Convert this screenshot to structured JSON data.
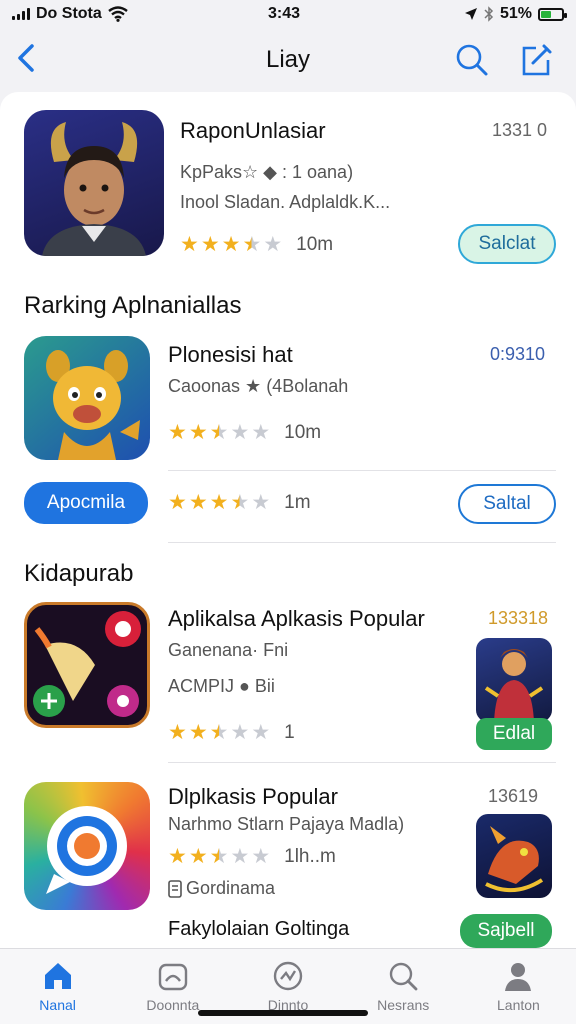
{
  "status_bar": {
    "carrier": "Do Stota",
    "time": "3:43",
    "battery": "51%",
    "battery_level": 0.51
  },
  "nav": {
    "title": "Liay"
  },
  "featured": {
    "name": "RaponUnlasiar",
    "code": "1331 0",
    "meta_line1": "KpPaks☆  ◆ : 1 oana)",
    "meta_line2": "Inool Sladan.  Adplaldk.K...",
    "rating": 3.5,
    "count": "10m",
    "button": "Salclat"
  },
  "ranking": {
    "section_title": "Rarking Aplnaniallas",
    "app": {
      "name": "Plonesisi hat",
      "code": "0:9310",
      "meta": "Caoonas ★  (4Bolanah",
      "rating": 2.5,
      "count": "10m"
    },
    "row2": {
      "left_button": "Apocmila",
      "rating": 3.5,
      "count": "1m",
      "right_button": "Saltal"
    }
  },
  "popular": {
    "section_title": "Kidapurab",
    "item1": {
      "name": "Aplikalsa Aplkasis Popular",
      "code": "133318",
      "meta_line1": "Ganenana·  Fni",
      "meta_line2": "ACMPIJ ●  Bii",
      "rating": 2.5,
      "count": "1",
      "button": "Edlal"
    },
    "item2": {
      "name": "Dlplkasis Popular",
      "code": "13619",
      "meta_line1": "Narhmo Stlarn  Pajaya Madla)",
      "rating": 2.5,
      "count": "1lh..m",
      "meta_line2": "Gordinama"
    },
    "item3": {
      "name": "Fakylolaian Goltinga",
      "button": "Sajbell"
    }
  },
  "tabs": [
    {
      "label": "Nanal",
      "icon": "home-icon",
      "active": true
    },
    {
      "label": "Doonnta",
      "icon": "games-icon",
      "active": false
    },
    {
      "label": "Dinnto",
      "icon": "apps-icon",
      "active": false
    },
    {
      "label": "Nesrans",
      "icon": "search-icon",
      "active": false
    },
    {
      "label": "Lanton",
      "icon": "profile-icon",
      "active": false
    }
  ],
  "colors": {
    "accent": "#1f74e0",
    "star": "#f2b01e",
    "green": "#2fa85a"
  }
}
